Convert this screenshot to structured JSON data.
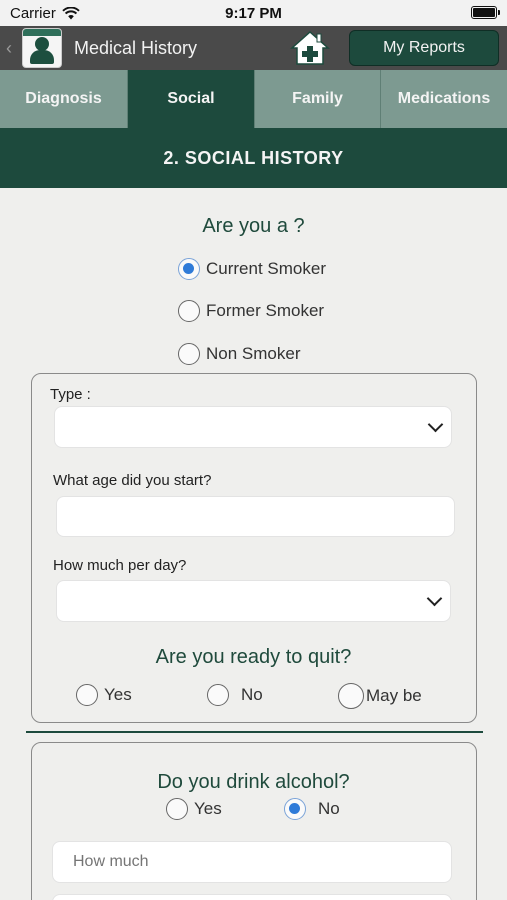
{
  "status_bar": {
    "carrier": "Carrier",
    "time": "9:17 PM"
  },
  "nav": {
    "title": "Medical History",
    "my_reports": "My Reports"
  },
  "tabs": [
    {
      "label": "Diagnosis",
      "active": false
    },
    {
      "label": "Social",
      "active": true
    },
    {
      "label": "Family",
      "active": false
    },
    {
      "label": "Medications",
      "active": false
    }
  ],
  "section_title": "2. SOCIAL HISTORY",
  "smoker": {
    "question": "Are you a ?",
    "options": [
      "Current Smoker",
      "Former Smoker",
      "Non Smoker"
    ],
    "selected": "Current Smoker"
  },
  "smoking_details": {
    "type_label": "Type :",
    "type_value": "",
    "age_label": "What age did you start?",
    "age_value": "",
    "per_day_label": "How much per day?",
    "per_day_value": "",
    "quit_question": "Are you ready to quit?",
    "quit_options": [
      "Yes",
      "No",
      "May be"
    ],
    "quit_selected": null
  },
  "alcohol": {
    "question": "Do you drink alcohol?",
    "options": [
      "Yes",
      "No"
    ],
    "selected": "No",
    "how_much_placeholder": "How much"
  },
  "colors": {
    "primary": "#1d4a3d",
    "tab_inactive": "#7d9a91",
    "nav_bg": "#4a4a4a",
    "radio_selected": "#2f7bd8"
  }
}
